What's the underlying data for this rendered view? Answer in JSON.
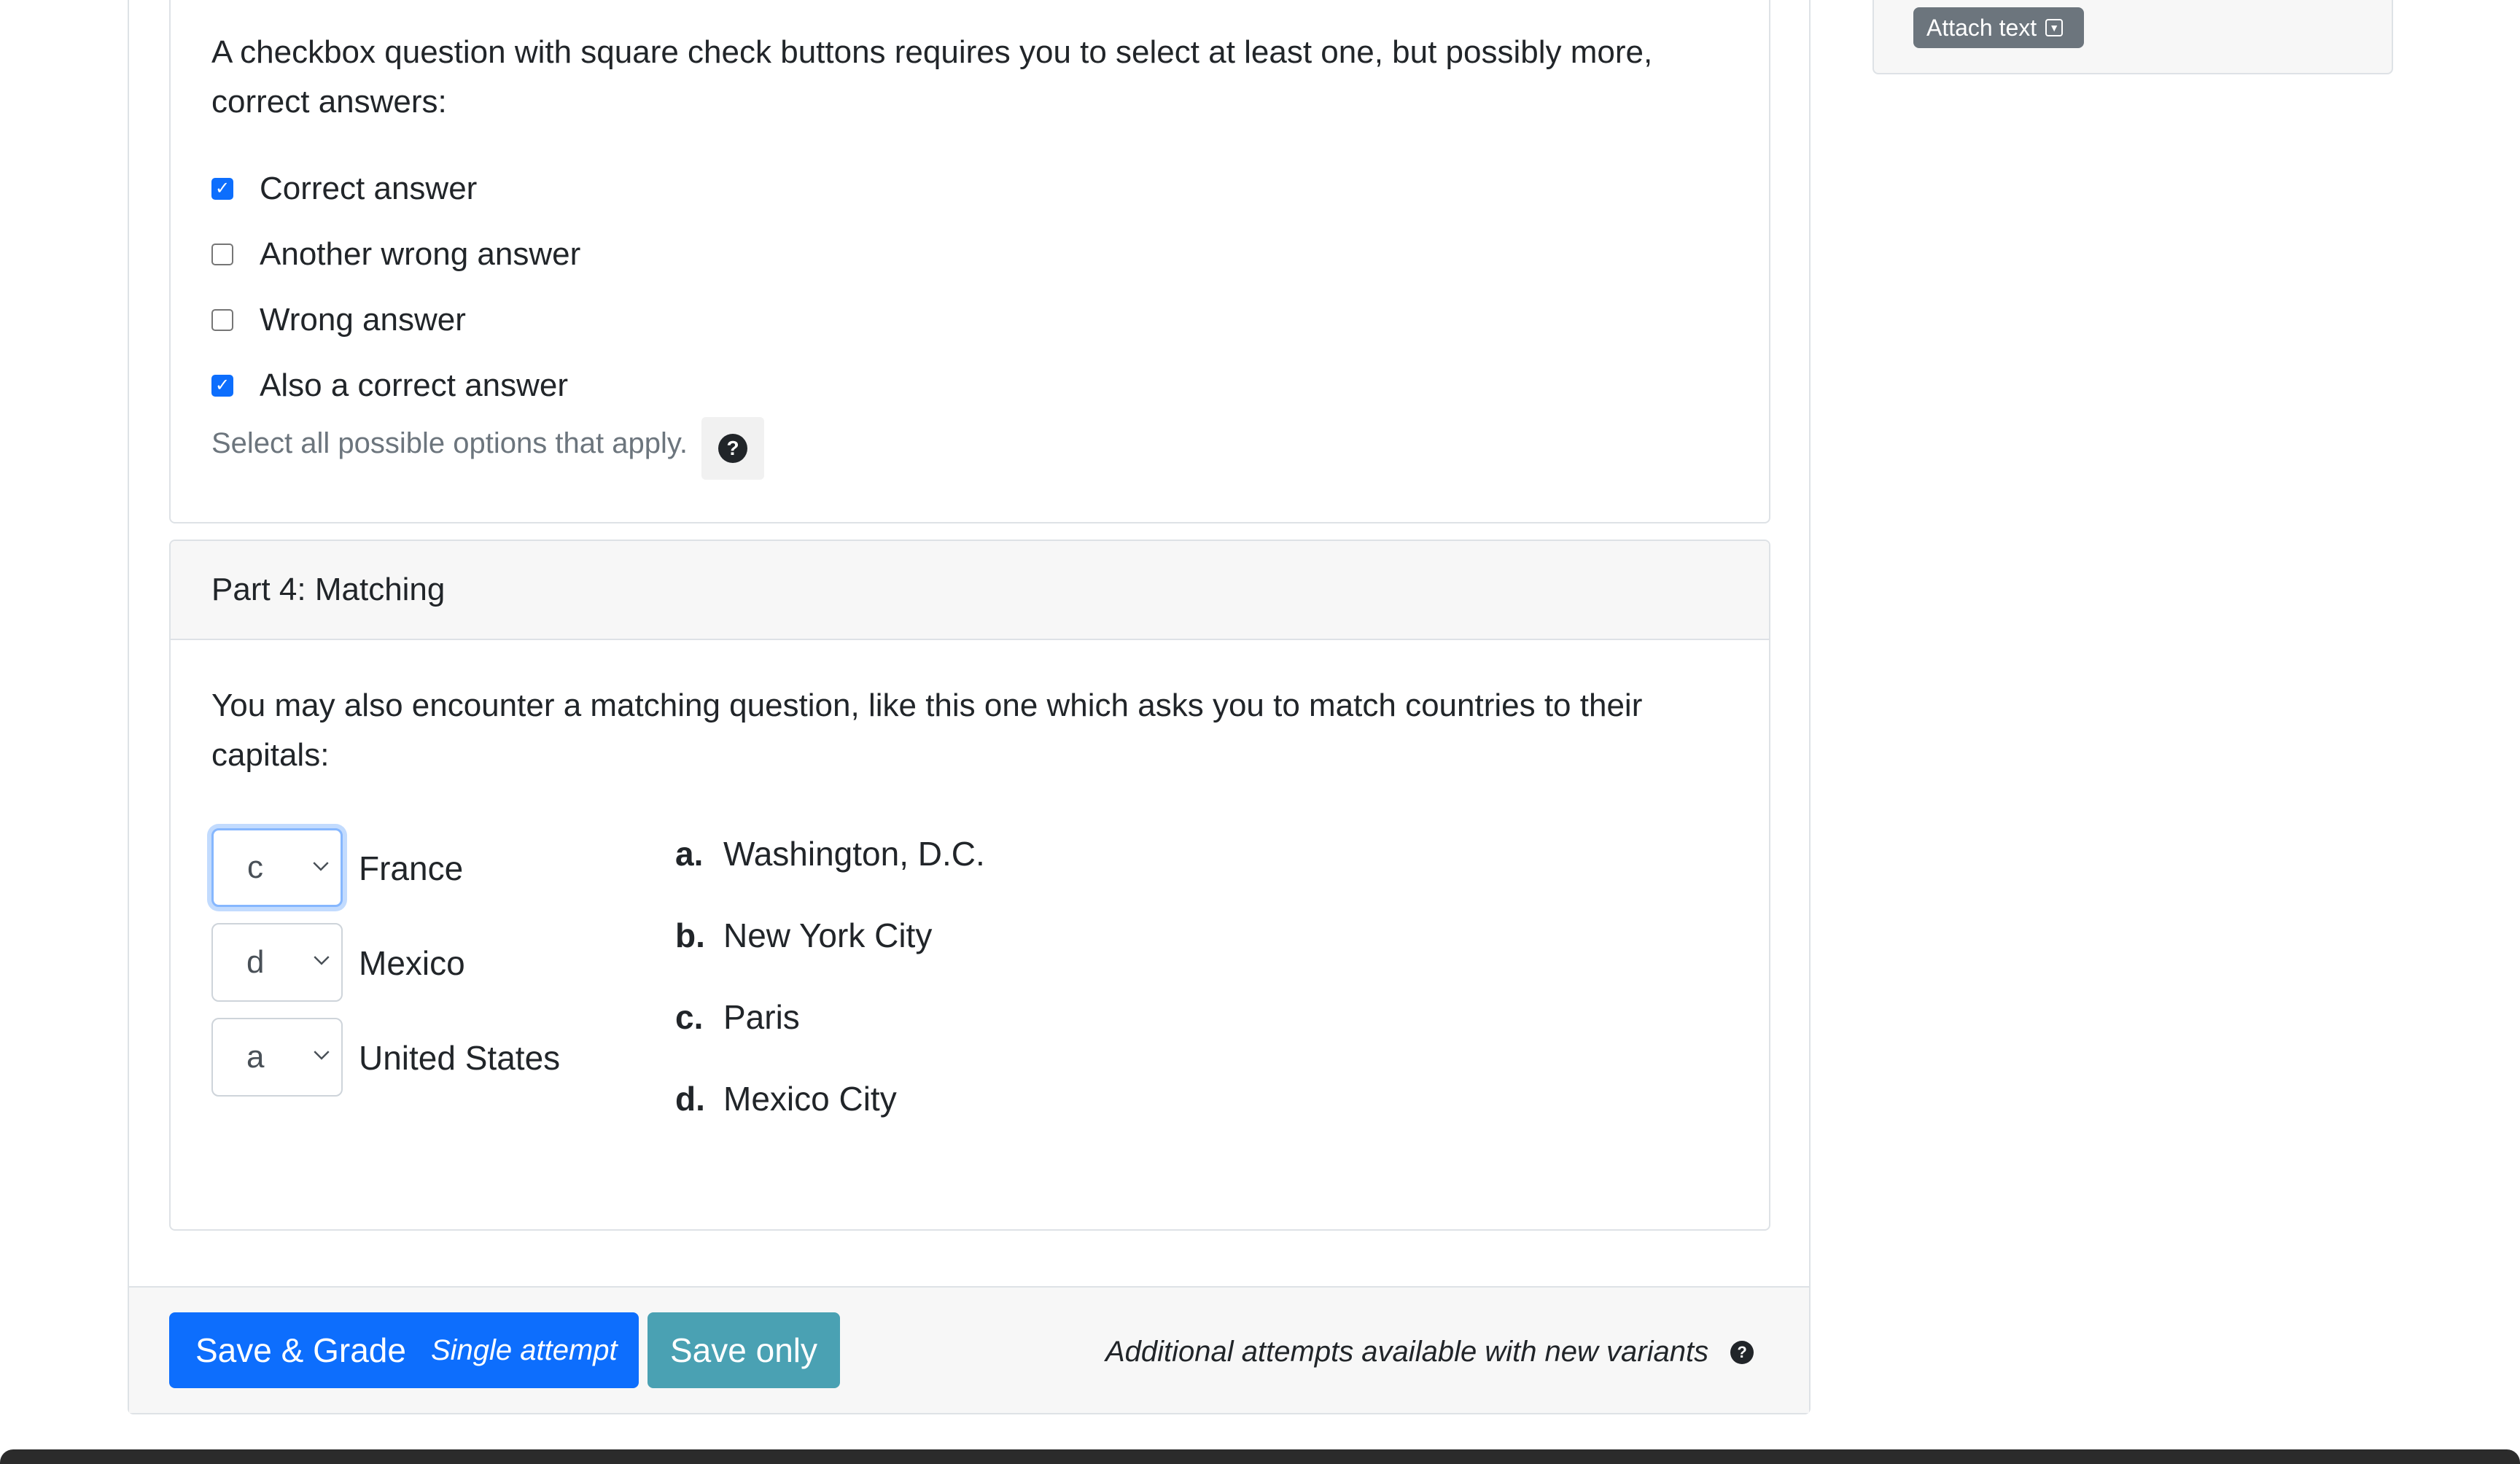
{
  "sidebar": {
    "attach_text_label": "Attach text"
  },
  "checkbox_part": {
    "question": "A checkbox question with square check buttons requires you to select at least one, but possibly more, correct answers:",
    "options": [
      {
        "label": "Correct answer",
        "checked": true
      },
      {
        "label": "Another wrong answer",
        "checked": false
      },
      {
        "label": "Wrong answer",
        "checked": false
      },
      {
        "label": "Also a correct answer",
        "checked": true
      }
    ],
    "help_text": "Select all possible options that apply."
  },
  "matching_part": {
    "title": "Part 4: Matching",
    "question": "You may also encounter a matching question, like this one which asks you to match countries to their capitals:",
    "rows": [
      {
        "selected": "c",
        "country": "France"
      },
      {
        "selected": "d",
        "country": "Mexico"
      },
      {
        "selected": "a",
        "country": "United States"
      }
    ],
    "choices": [
      {
        "key": "a.",
        "text": "Washington, D.C."
      },
      {
        "key": "b.",
        "text": "New York City"
      },
      {
        "key": "c.",
        "text": "Paris"
      },
      {
        "key": "d.",
        "text": "Mexico City"
      }
    ]
  },
  "footer": {
    "save_grade_label": "Save & Grade",
    "save_grade_sub": "Single attempt",
    "save_only_label": "Save only",
    "attempts_text": "Additional attempts available with new variants"
  },
  "colors": {
    "primary": "#0d6efd",
    "info": "#4aa1b3",
    "secondary": "#6c757d"
  }
}
